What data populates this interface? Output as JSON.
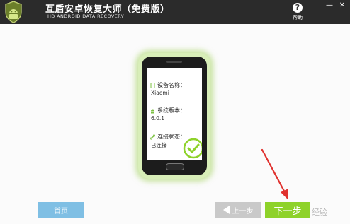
{
  "window": {
    "title": "互盾安卓恢复大师（免费版）",
    "subtitle": "HD ANDROID DATA RECOVERY",
    "help_label": "帮助",
    "minimize_glyph": "—",
    "close_glyph": "✕"
  },
  "device": {
    "name_label": "设备名称：",
    "name_value": "Xiaomi",
    "version_label": "系统版本：",
    "version_value": "6.0.1",
    "status_label": "连接状态：",
    "status_value": "已连接"
  },
  "footer": {
    "home_label": "首页",
    "prev_label": "上一步",
    "next_label": "下一步"
  },
  "watermark": "经验",
  "colors": {
    "titlebar": "#2b2b2b",
    "accent_green": "#8ed22a",
    "home_blue": "#7fbfe4",
    "prev_gray": "#c9c9c9",
    "annotation_arrow": "#e0312e"
  },
  "icons": [
    "shield-android-logo-icon",
    "help-icon",
    "phone-icon",
    "android-icon",
    "link-icon",
    "check-icon",
    "left-arrow-icon"
  ]
}
